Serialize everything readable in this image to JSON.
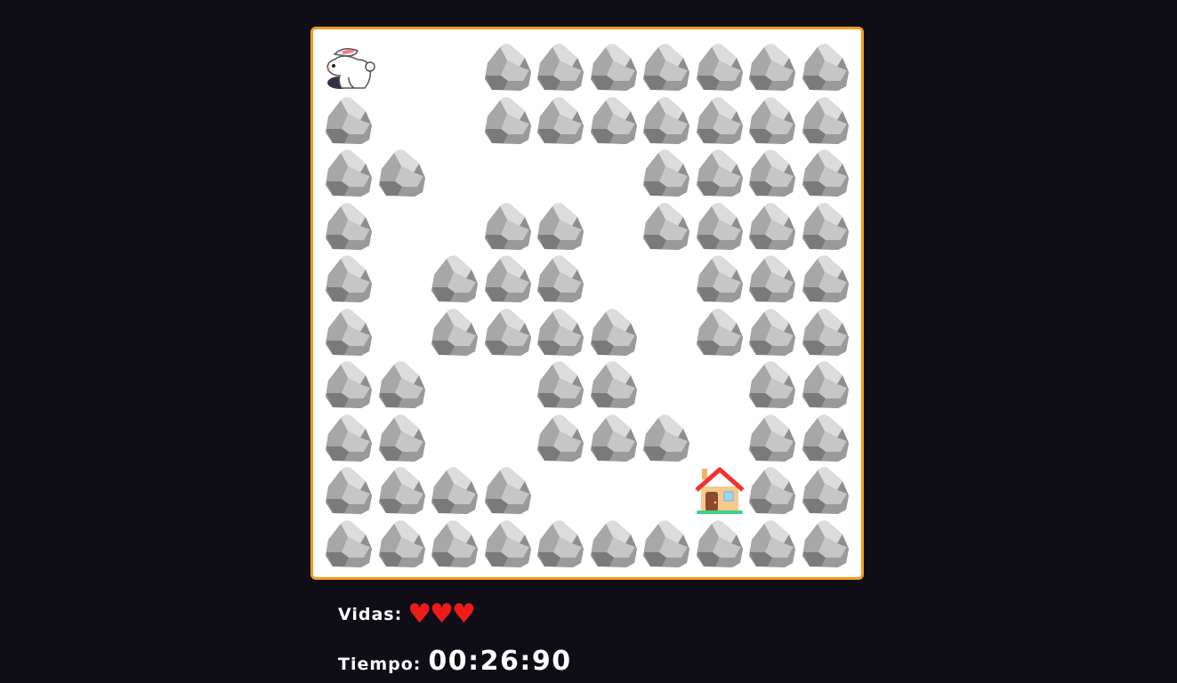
{
  "game": {
    "grid": [
      "P..RRRRRRR",
      "R..RRRRRRR",
      "RR....RRRR",
      "R..RR.RRRR",
      "R.RRR..RRR",
      "R.RRRR.RRR",
      "RR..RR..RR",
      "RR..RRR.RR",
      "RRRR...HRR",
      "RRRRRRRRRR"
    ],
    "legend": {
      "R": "rock-icon",
      "P": "rabbit-icon",
      "H": "house-icon",
      ".": "empty"
    }
  },
  "hud": {
    "lives_label": "Vidas:",
    "lives_hearts": "♥♥♥",
    "time_label": "Tiempo:",
    "time_value": "00:26:90"
  },
  "colors": {
    "background": "#0f0e17",
    "board_border": "#f59a1c",
    "heart": "#f11a1a"
  }
}
